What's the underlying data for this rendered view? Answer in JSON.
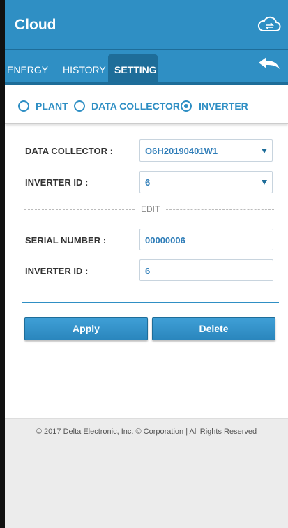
{
  "app": {
    "title": "Cloud",
    "accent": "#2f8fc4",
    "accent_dark": "#1e6d99"
  },
  "tabs": [
    {
      "label": "ENERGY",
      "active": false
    },
    {
      "label": "HISTORY",
      "active": false
    },
    {
      "label": "SETTING",
      "active": true
    }
  ],
  "icons": {
    "cloud": "cloud-sync-icon",
    "back": "back-arrow-icon"
  },
  "radios": [
    {
      "label": "PLANT",
      "checked": false
    },
    {
      "label": "DATA COLLECTOR",
      "checked": false
    },
    {
      "label": "INVERTER",
      "checked": true
    }
  ],
  "form": {
    "data_collector": {
      "label": "DATA COLLECTOR :",
      "value": "O6H20190401W1"
    },
    "inverter_select": {
      "label": "INVERTER ID :",
      "value": "6"
    },
    "edit_label": "EDIT",
    "serial_number": {
      "label": "SERIAL NUMBER :",
      "value": "00000006"
    },
    "inverter_input": {
      "label": "INVERTER ID :",
      "value": "6"
    }
  },
  "buttons": {
    "apply": "Apply",
    "delete": "Delete"
  },
  "footer": {
    "text": "© 2017 Delta Electronic, Inc. © Corporation | All Rights Reserved"
  }
}
